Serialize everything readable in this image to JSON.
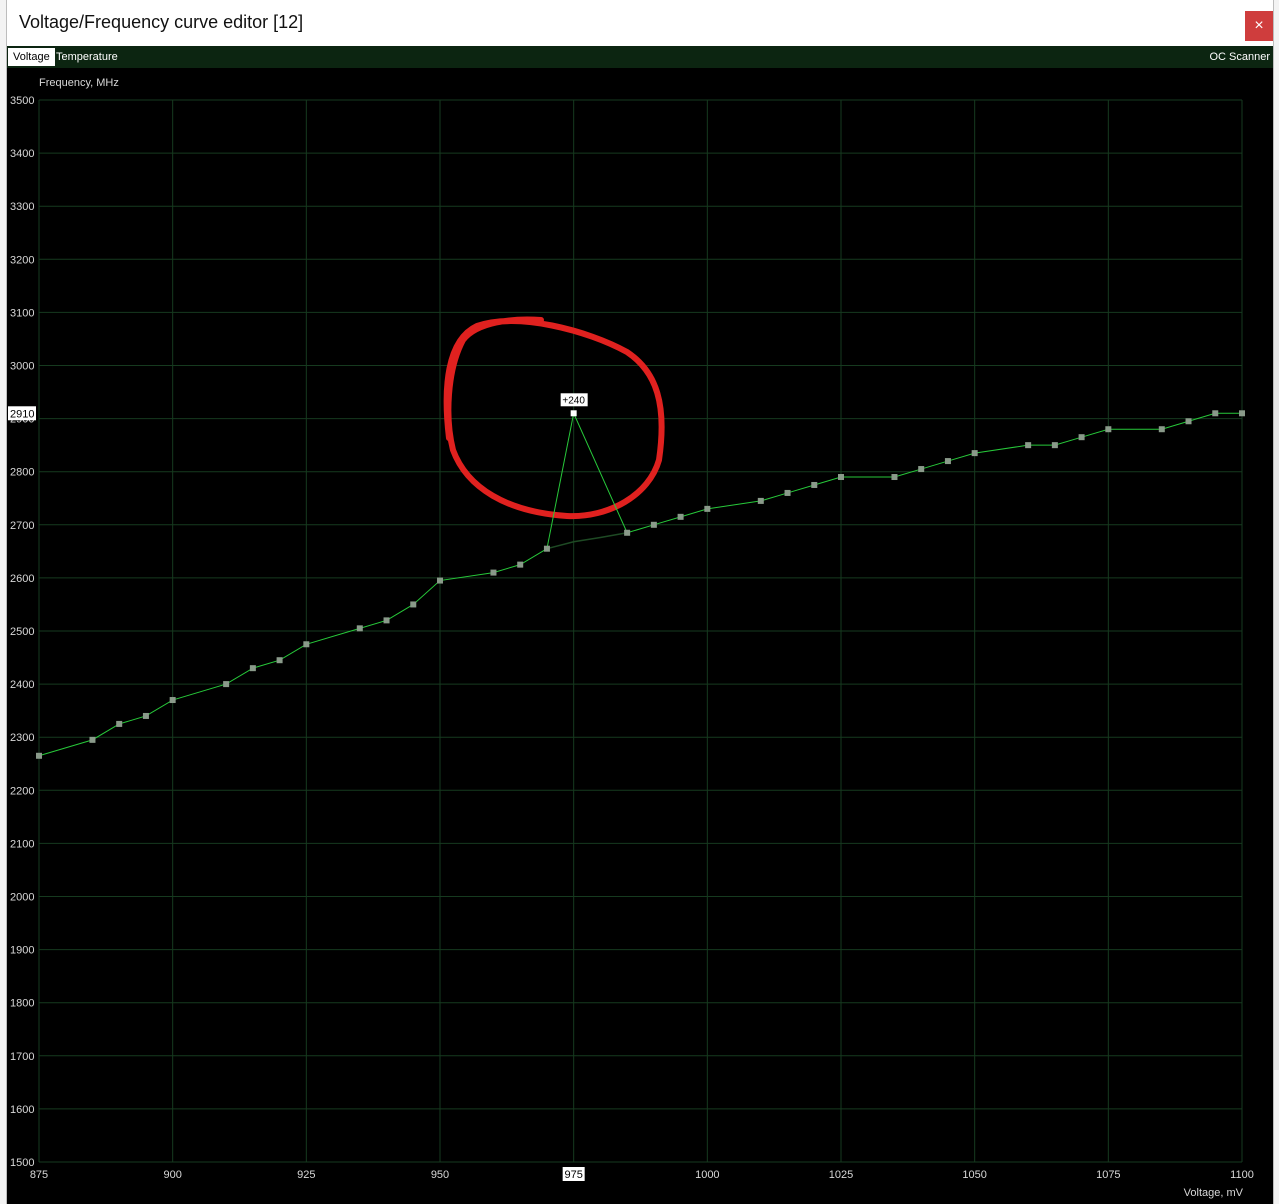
{
  "window": {
    "title": "Voltage/Frequency curve editor [12]",
    "close_label": "×"
  },
  "tabs": [
    {
      "label": "Voltage",
      "active": true
    },
    {
      "label": "Temperature",
      "active": false
    }
  ],
  "oc_scanner_label": "OC Scanner",
  "colors": {
    "curve": "#27c93a",
    "grid": "#163a1f",
    "point": "#8a9a8a",
    "annotation": "#e0211f"
  },
  "chart_data": {
    "type": "line",
    "ylabel": "Frequency, MHz",
    "xlabel": "Voltage, mV",
    "xlim": [
      875,
      1100
    ],
    "ylim": [
      1500,
      3500
    ],
    "xticks": [
      875,
      900,
      925,
      950,
      975,
      1000,
      1025,
      1050,
      1075,
      1100
    ],
    "yticks": [
      1500,
      1600,
      1700,
      1800,
      1900,
      2000,
      2100,
      2200,
      2300,
      2400,
      2500,
      2600,
      2700,
      2800,
      2900,
      3000,
      3100,
      3200,
      3300,
      3400,
      3500
    ],
    "points": [
      [
        875,
        2265
      ],
      [
        885,
        2295
      ],
      [
        890,
        2325
      ],
      [
        895,
        2340
      ],
      [
        900,
        2370
      ],
      [
        910,
        2400
      ],
      [
        915,
        2430
      ],
      [
        920,
        2445
      ],
      [
        925,
        2475
      ],
      [
        935,
        2505
      ],
      [
        940,
        2520
      ],
      [
        945,
        2550
      ],
      [
        950,
        2595
      ],
      [
        960,
        2610
      ],
      [
        965,
        2625
      ],
      [
        970,
        2655
      ],
      [
        975,
        2910
      ],
      [
        985,
        2685
      ],
      [
        990,
        2700
      ],
      [
        995,
        2715
      ],
      [
        1000,
        2730
      ],
      [
        1010,
        2745
      ],
      [
        1015,
        2760
      ],
      [
        1020,
        2775
      ],
      [
        1025,
        2790
      ],
      [
        1035,
        2790
      ],
      [
        1040,
        2805
      ],
      [
        1045,
        2820
      ],
      [
        1050,
        2835
      ],
      [
        1060,
        2850
      ],
      [
        1065,
        2850
      ],
      [
        1070,
        2865
      ],
      [
        1075,
        2880
      ],
      [
        1085,
        2880
      ],
      [
        1090,
        2895
      ],
      [
        1095,
        2910
      ],
      [
        1100,
        2910
      ]
    ],
    "base_curve": [
      [
        970,
        2655
      ],
      [
        975,
        2668
      ],
      [
        980,
        2676
      ],
      [
        985,
        2685
      ]
    ],
    "selected_point": {
      "x": 975,
      "y": 2910,
      "offset_label": "+240",
      "y_readout": "2910",
      "x_readout": "975"
    }
  }
}
